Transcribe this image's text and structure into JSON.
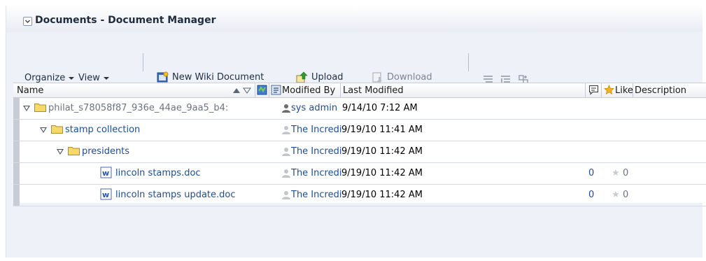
{
  "panel": {
    "title": "Documents - Document Manager"
  },
  "toolbar": {
    "organize": "Organize",
    "view": "View",
    "new_wiki": "New Wiki Document",
    "upload": "Upload",
    "download": "Download"
  },
  "columns": {
    "name": "Name",
    "modified_by": "Modified By",
    "last_modified": "Last Modified",
    "like": "Like",
    "description": "Description"
  },
  "rows": [
    {
      "name": "philat_s78058f87_936e_44ae_9aa5_b4:",
      "type": "folder",
      "level": 0,
      "modified_by": "sys admin",
      "last_modified": "9/14/10 7:12 AM",
      "comments": "",
      "likes": ""
    },
    {
      "name": "stamp collection",
      "type": "folder",
      "level": 1,
      "modified_by": "The Incredibl",
      "last_modified": "9/19/10 11:41 AM",
      "comments": "",
      "likes": ""
    },
    {
      "name": "presidents",
      "type": "folder",
      "level": 2,
      "modified_by": "The Incredibl",
      "last_modified": "9/19/10 11:42 AM",
      "comments": "",
      "likes": ""
    },
    {
      "name": "lincoln stamps.doc",
      "type": "doc",
      "level": 3,
      "modified_by": "The Incredibl",
      "last_modified": "9/19/10 11:42 AM",
      "comments": "0",
      "likes": "0"
    },
    {
      "name": "lincoln stamps update.doc",
      "type": "doc",
      "level": 3,
      "modified_by": "The Incredibl",
      "last_modified": "9/19/10 11:42 AM",
      "comments": "0",
      "likes": "0"
    }
  ]
}
